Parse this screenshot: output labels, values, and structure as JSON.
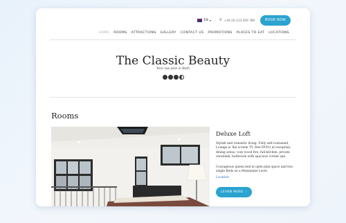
{
  "header": {
    "language": "EN",
    "phone": "+44 (0) 123 456 789",
    "book_label": "BOOK NOW"
  },
  "nav": {
    "items": [
      {
        "label": "HOME"
      },
      {
        "label": "ROOMS"
      },
      {
        "label": "ATTRACTIONS"
      },
      {
        "label": "GALLERY"
      },
      {
        "label": "CONTACT US"
      },
      {
        "label": "PROMOTIONS"
      },
      {
        "label": "PLACES TO EAT"
      },
      {
        "label": "LOCATIONS"
      }
    ],
    "active_index": 0
  },
  "hero": {
    "title": "The Classic Beauty",
    "subtitle": "Your top pick in Bath"
  },
  "rooms": {
    "heading": "Rooms",
    "room": {
      "title": "Deluxe Loft",
      "description": "Stylish and romantic living. Fully self-contained, Lounge w. flat screen TV, free DVD's at reception, dining areas, cosy wood fire, full kitchen, private verandah, bathroom with spacious corner spa.",
      "beds": "Courageous queen bed in open plan space and two single Beds on a Mezzanine Level.",
      "location_label": "Location",
      "learn_more_label": "LEARN MORE"
    }
  },
  "colors": {
    "accent": "#2aa3cf",
    "link": "#2a6fbf"
  }
}
